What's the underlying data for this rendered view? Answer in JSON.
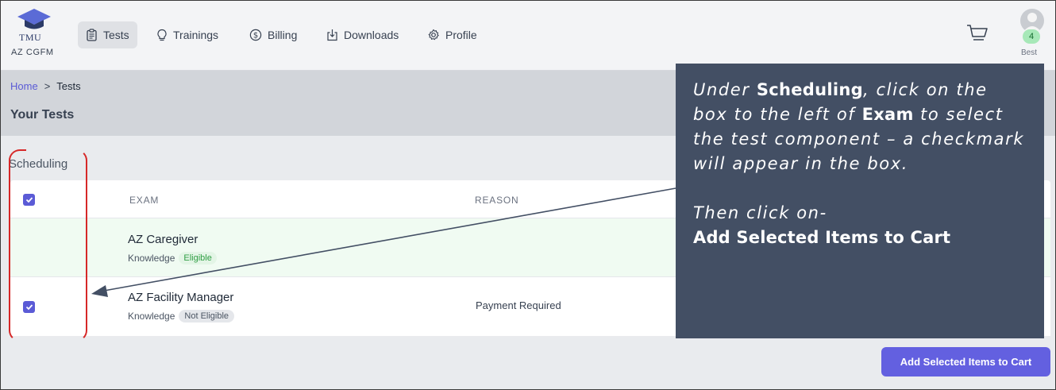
{
  "app": {
    "logo_text": "TMU",
    "org": "AZ CGFM",
    "user_name": "Best",
    "cart_count": "4"
  },
  "nav": [
    {
      "label": "Tests",
      "icon": "clipboard-icon",
      "active": true
    },
    {
      "label": "Trainings",
      "icon": "lightbulb-icon"
    },
    {
      "label": "Billing",
      "icon": "dollar-icon"
    },
    {
      "label": "Downloads",
      "icon": "download-icon"
    },
    {
      "label": "Profile",
      "icon": "gear-icon"
    }
  ],
  "breadcrumb": {
    "home": "Home",
    "separator": ">",
    "current": "Tests"
  },
  "page": {
    "title": "Your Tests",
    "section": "Scheduling"
  },
  "table": {
    "headers": {
      "exam": "EXAM",
      "reason": "REASON"
    },
    "rows": [
      {
        "name": "AZ Caregiver",
        "type": "Knowledge",
        "status": "Eligible",
        "reason": "",
        "checked": false
      },
      {
        "name": "AZ Facility Manager",
        "type": "Knowledge",
        "status": "Not Eligible",
        "reason": "Payment Required",
        "checked": true
      }
    ]
  },
  "actions": {
    "add_to_cart": "Add Selected Items to Cart"
  },
  "callout": {
    "p1_a": "Under ",
    "p1_b": "Scheduling",
    "p1_c": ", click on the box to the left of ",
    "p1_d": "Exam",
    "p1_e": " to select the test component – a checkmark will appear in the box.",
    "p2": "Then click on-",
    "p3": "Add Selected Items to Cart"
  },
  "colors": {
    "accent": "#6360e0",
    "callout_bg": "#434f64",
    "bracket": "#d62828",
    "eligible": "#2f9e44"
  }
}
